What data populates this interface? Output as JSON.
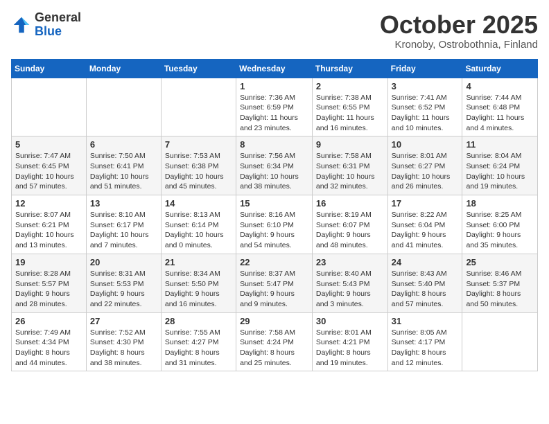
{
  "logo": {
    "general": "General",
    "blue": "Blue"
  },
  "title": "October 2025",
  "subtitle": "Kronoby, Ostrobothnia, Finland",
  "days_header": [
    "Sunday",
    "Monday",
    "Tuesday",
    "Wednesday",
    "Thursday",
    "Friday",
    "Saturday"
  ],
  "weeks": [
    [
      {
        "day": "",
        "info": ""
      },
      {
        "day": "",
        "info": ""
      },
      {
        "day": "",
        "info": ""
      },
      {
        "day": "1",
        "info": "Sunrise: 7:36 AM\nSunset: 6:59 PM\nDaylight: 11 hours\nand 23 minutes."
      },
      {
        "day": "2",
        "info": "Sunrise: 7:38 AM\nSunset: 6:55 PM\nDaylight: 11 hours\nand 16 minutes."
      },
      {
        "day": "3",
        "info": "Sunrise: 7:41 AM\nSunset: 6:52 PM\nDaylight: 11 hours\nand 10 minutes."
      },
      {
        "day": "4",
        "info": "Sunrise: 7:44 AM\nSunset: 6:48 PM\nDaylight: 11 hours\nand 4 minutes."
      }
    ],
    [
      {
        "day": "5",
        "info": "Sunrise: 7:47 AM\nSunset: 6:45 PM\nDaylight: 10 hours\nand 57 minutes."
      },
      {
        "day": "6",
        "info": "Sunrise: 7:50 AM\nSunset: 6:41 PM\nDaylight: 10 hours\nand 51 minutes."
      },
      {
        "day": "7",
        "info": "Sunrise: 7:53 AM\nSunset: 6:38 PM\nDaylight: 10 hours\nand 45 minutes."
      },
      {
        "day": "8",
        "info": "Sunrise: 7:56 AM\nSunset: 6:34 PM\nDaylight: 10 hours\nand 38 minutes."
      },
      {
        "day": "9",
        "info": "Sunrise: 7:58 AM\nSunset: 6:31 PM\nDaylight: 10 hours\nand 32 minutes."
      },
      {
        "day": "10",
        "info": "Sunrise: 8:01 AM\nSunset: 6:27 PM\nDaylight: 10 hours\nand 26 minutes."
      },
      {
        "day": "11",
        "info": "Sunrise: 8:04 AM\nSunset: 6:24 PM\nDaylight: 10 hours\nand 19 minutes."
      }
    ],
    [
      {
        "day": "12",
        "info": "Sunrise: 8:07 AM\nSunset: 6:21 PM\nDaylight: 10 hours\nand 13 minutes."
      },
      {
        "day": "13",
        "info": "Sunrise: 8:10 AM\nSunset: 6:17 PM\nDaylight: 10 hours\nand 7 minutes."
      },
      {
        "day": "14",
        "info": "Sunrise: 8:13 AM\nSunset: 6:14 PM\nDaylight: 10 hours\nand 0 minutes."
      },
      {
        "day": "15",
        "info": "Sunrise: 8:16 AM\nSunset: 6:10 PM\nDaylight: 9 hours\nand 54 minutes."
      },
      {
        "day": "16",
        "info": "Sunrise: 8:19 AM\nSunset: 6:07 PM\nDaylight: 9 hours\nand 48 minutes."
      },
      {
        "day": "17",
        "info": "Sunrise: 8:22 AM\nSunset: 6:04 PM\nDaylight: 9 hours\nand 41 minutes."
      },
      {
        "day": "18",
        "info": "Sunrise: 8:25 AM\nSunset: 6:00 PM\nDaylight: 9 hours\nand 35 minutes."
      }
    ],
    [
      {
        "day": "19",
        "info": "Sunrise: 8:28 AM\nSunset: 5:57 PM\nDaylight: 9 hours\nand 28 minutes."
      },
      {
        "day": "20",
        "info": "Sunrise: 8:31 AM\nSunset: 5:53 PM\nDaylight: 9 hours\nand 22 minutes."
      },
      {
        "day": "21",
        "info": "Sunrise: 8:34 AM\nSunset: 5:50 PM\nDaylight: 9 hours\nand 16 minutes."
      },
      {
        "day": "22",
        "info": "Sunrise: 8:37 AM\nSunset: 5:47 PM\nDaylight: 9 hours\nand 9 minutes."
      },
      {
        "day": "23",
        "info": "Sunrise: 8:40 AM\nSunset: 5:43 PM\nDaylight: 9 hours\nand 3 minutes."
      },
      {
        "day": "24",
        "info": "Sunrise: 8:43 AM\nSunset: 5:40 PM\nDaylight: 8 hours\nand 57 minutes."
      },
      {
        "day": "25",
        "info": "Sunrise: 8:46 AM\nSunset: 5:37 PM\nDaylight: 8 hours\nand 50 minutes."
      }
    ],
    [
      {
        "day": "26",
        "info": "Sunrise: 7:49 AM\nSunset: 4:34 PM\nDaylight: 8 hours\nand 44 minutes."
      },
      {
        "day": "27",
        "info": "Sunrise: 7:52 AM\nSunset: 4:30 PM\nDaylight: 8 hours\nand 38 minutes."
      },
      {
        "day": "28",
        "info": "Sunrise: 7:55 AM\nSunset: 4:27 PM\nDaylight: 8 hours\nand 31 minutes."
      },
      {
        "day": "29",
        "info": "Sunrise: 7:58 AM\nSunset: 4:24 PM\nDaylight: 8 hours\nand 25 minutes."
      },
      {
        "day": "30",
        "info": "Sunrise: 8:01 AM\nSunset: 4:21 PM\nDaylight: 8 hours\nand 19 minutes."
      },
      {
        "day": "31",
        "info": "Sunrise: 8:05 AM\nSunset: 4:17 PM\nDaylight: 8 hours\nand 12 minutes."
      },
      {
        "day": "",
        "info": ""
      }
    ]
  ]
}
